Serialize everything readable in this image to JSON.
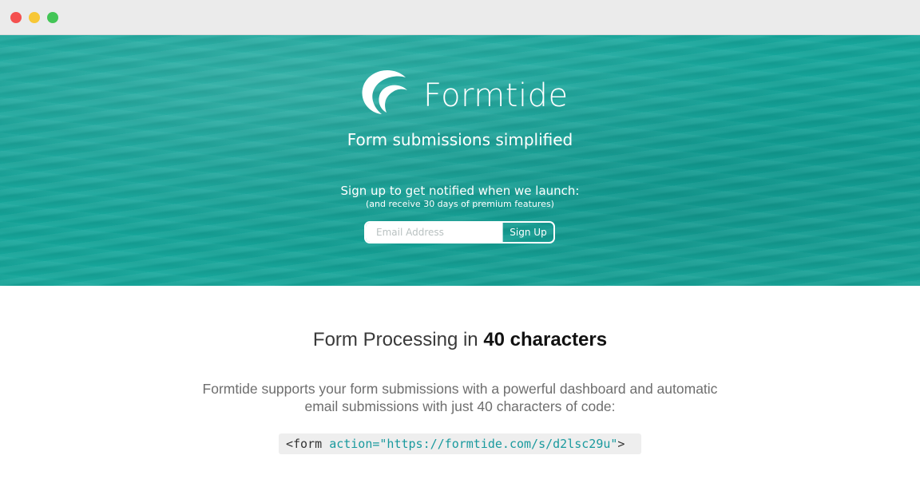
{
  "window": {
    "controls": [
      "close",
      "minimize",
      "maximize"
    ]
  },
  "hero": {
    "brand": "Formtide",
    "logo_icon": "wave-logo-icon",
    "tagline": "Form submissions simplified",
    "signup_text": "Sign up to get notified when we launch:",
    "signup_subtext": "(and receive 30 days of premium features)",
    "email_placeholder": "Email Address",
    "email_value": "",
    "signup_button": "Sign Up"
  },
  "content": {
    "heading_prefix": "Form Processing in",
    "heading_highlight": "40 characters",
    "description_line1": "Formtide supports your form submissions with a powerful dashboard and automatic",
    "description_line2": "email submissions with just 40 characters of code:",
    "code_tag": "<form",
    "code_attr": "action=",
    "code_value": "\"https://formtide.com/s/d2lsc29u\"",
    "code_close": ">"
  },
  "colors": {
    "hero_teal": "#16a79c",
    "code_accent": "#1a9a9e",
    "close": "#f4504f",
    "minimize": "#f7c736",
    "maximize": "#43c556"
  }
}
